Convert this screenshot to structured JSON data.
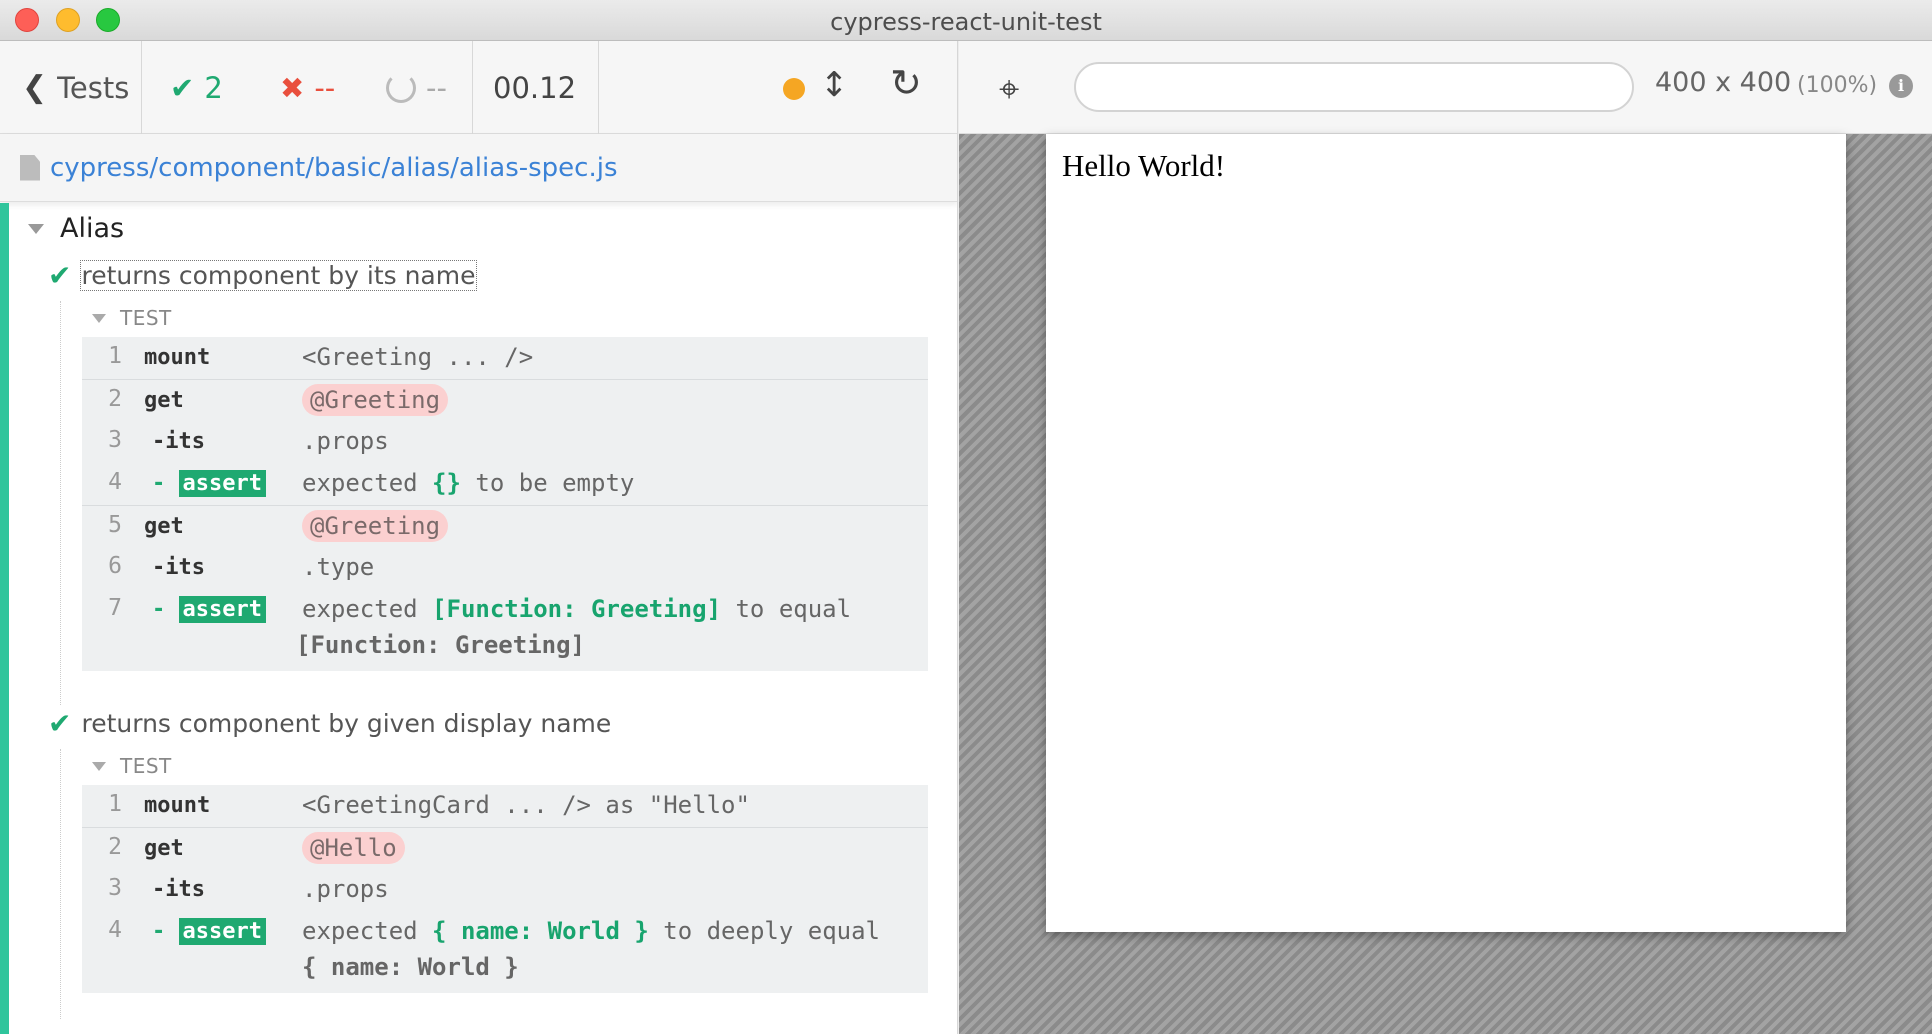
{
  "window": {
    "title": "cypress-react-unit-test"
  },
  "stats": {
    "back_label": "Tests",
    "passed": "2",
    "failed": "--",
    "pending": "--",
    "duration": "00.12",
    "status_color": "#f5a623"
  },
  "spec": {
    "path": "cypress/component/basic/alias/alias-spec.js"
  },
  "suite": {
    "title": "Alias",
    "tests": [
      {
        "title": "returns component by its name",
        "hook": "TEST",
        "commands": [
          {
            "num": "1",
            "name": "mount",
            "msg": "<Greeting ... />"
          },
          {
            "num": "2",
            "name": "get",
            "msg": "@Greeting"
          },
          {
            "num": "3",
            "name": "-its",
            "msg": ".props"
          },
          {
            "num": "4",
            "name": "assert",
            "msg_pre": "expected",
            "msg_a": "{}",
            "msg_mid": "to be empty"
          },
          {
            "num": "5",
            "name": "get",
            "msg": "@Greeting"
          },
          {
            "num": "6",
            "name": "-its",
            "msg": ".type"
          },
          {
            "num": "7",
            "name": "assert",
            "msg_pre": "expected",
            "msg_a": "[Function: Greeting]",
            "msg_mid": "to equal",
            "msg_b": "[Function: Greeting]"
          }
        ]
      },
      {
        "title": "returns component by given display name",
        "hook": "TEST",
        "commands": [
          {
            "num": "1",
            "name": "mount",
            "msg": "<GreetingCard ... /> as \"Hello\""
          },
          {
            "num": "2",
            "name": "get",
            "msg": "@Hello"
          },
          {
            "num": "3",
            "name": "-its",
            "msg": ".props"
          },
          {
            "num": "4",
            "name": "assert",
            "msg_pre": "expected",
            "msg_a": "{ name: World }",
            "msg_mid": "to deeply equal",
            "msg_b": "{ name: World }"
          }
        ]
      }
    ]
  },
  "aut": {
    "url": "",
    "viewport": "400 x 400",
    "scale": "(100%)",
    "content": "Hello World!"
  },
  "icons": {
    "back": "chevron-left-icon",
    "passed": "check-icon",
    "failed": "x-icon",
    "pending": "circle-notch-icon",
    "reload": "reload-icon",
    "selector": "crosshair-icon",
    "info": "info-icon"
  }
}
